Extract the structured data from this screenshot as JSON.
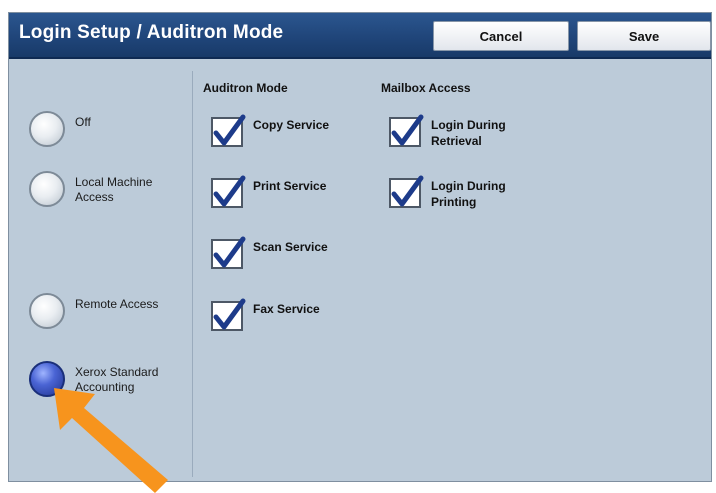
{
  "header": {
    "title": "Login Setup / Auditron Mode",
    "cancel_label": "Cancel",
    "save_label": "Save"
  },
  "login_options": [
    {
      "label": "Off",
      "selected": false
    },
    {
      "label": "Local Machine Access",
      "selected": false
    },
    {
      "label": "Remote Access",
      "selected": false
    },
    {
      "label": "Xerox Standard Accounting",
      "selected": true
    }
  ],
  "auditron_mode": {
    "heading": "Auditron Mode",
    "items": [
      {
        "label": "Copy Service",
        "checked": true
      },
      {
        "label": "Print Service",
        "checked": true
      },
      {
        "label": "Scan Service",
        "checked": true
      },
      {
        "label": "Fax Service",
        "checked": true
      }
    ]
  },
  "mailbox_access": {
    "heading": "Mailbox Access",
    "items": [
      {
        "label": "Login During Retrieval",
        "checked": true
      },
      {
        "label": "Login During Printing",
        "checked": true
      }
    ]
  },
  "colors": {
    "title_bar": "#1f4478",
    "panel": "#bccbd9",
    "selected_radio": "#3a52c0",
    "annotation_arrow": "#f7941d"
  },
  "annotation": {
    "icon": "orange-arrow-icon"
  }
}
